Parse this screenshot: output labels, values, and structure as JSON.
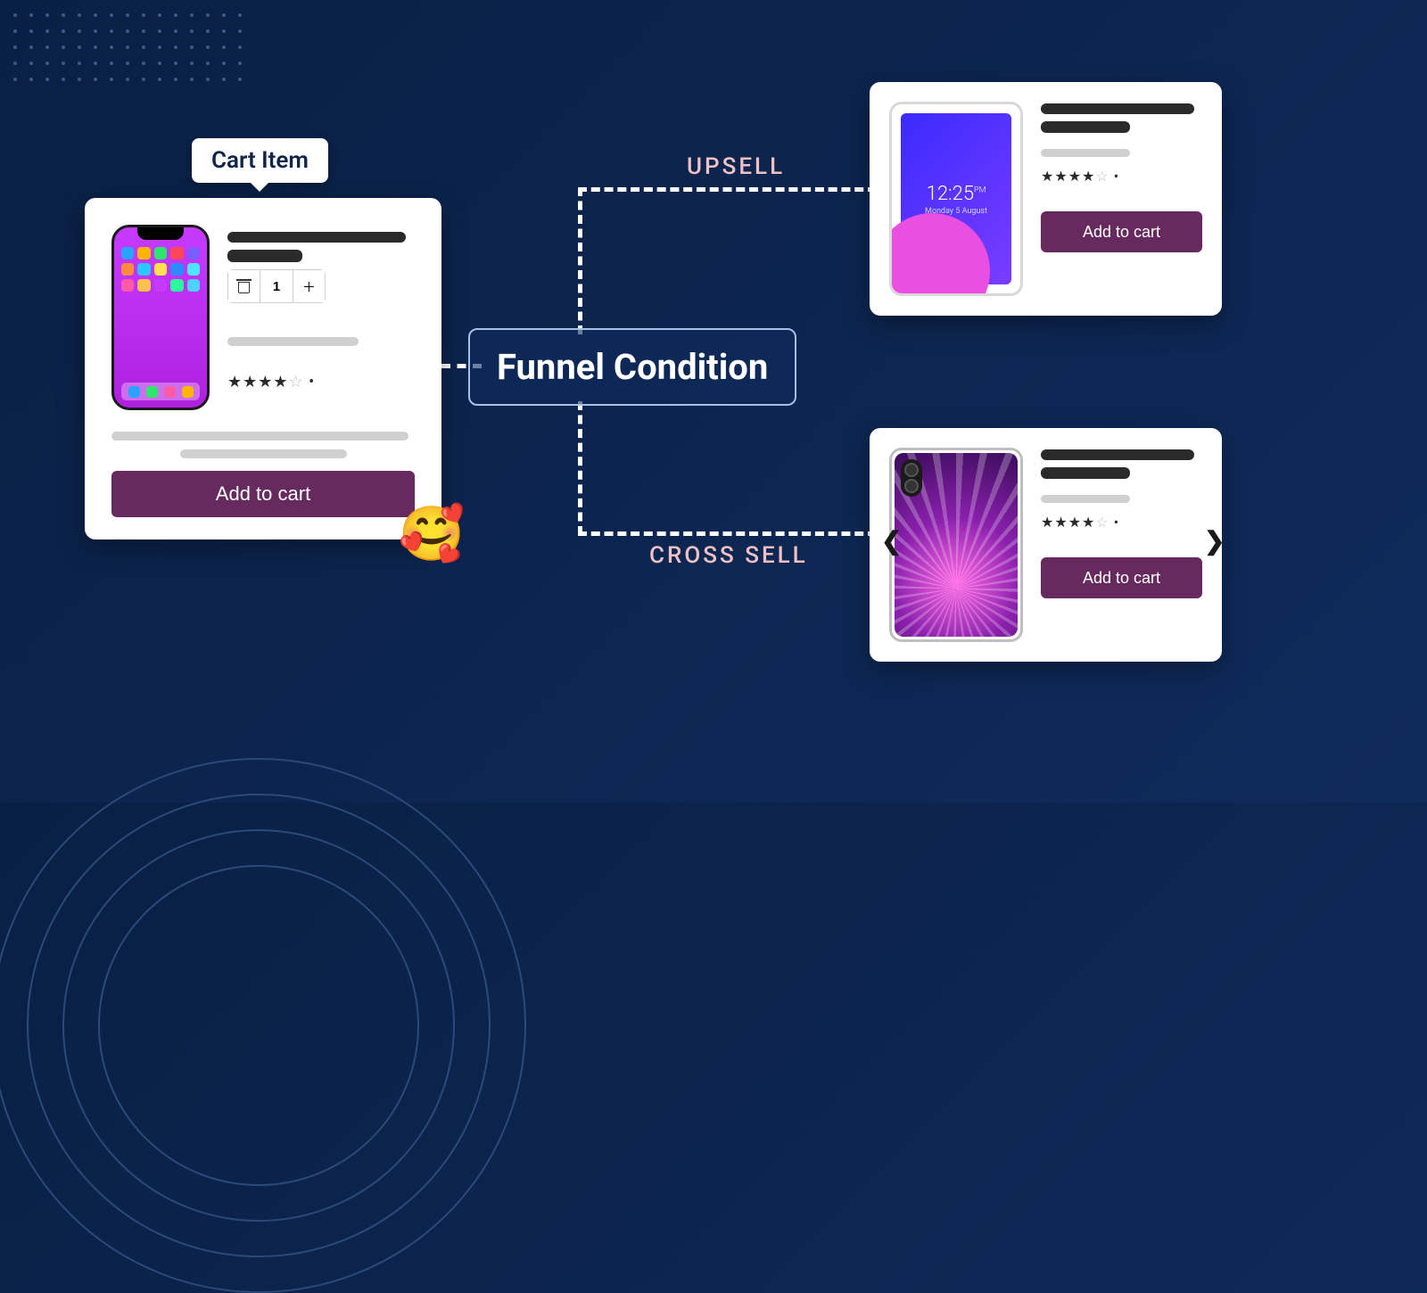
{
  "tooltip": "Cart Item",
  "center_node": "Funnel Condition",
  "labels": {
    "upsell": "UPSELL",
    "cross_sell": "CROSS SELL"
  },
  "cart": {
    "device_name": "smartphone",
    "quantity": "1",
    "rating": 4,
    "rating_max": 5,
    "add_to_cart": "Add to cart"
  },
  "upsell": {
    "device_name": "tablet",
    "lock_time": "12:25",
    "lock_time_suffix": "PM",
    "lock_date": "Monday 5 August",
    "rating": 4,
    "rating_max": 5,
    "add_to_cart": "Add to cart"
  },
  "cross_sell": {
    "device_name": "phone-case",
    "rating": 4,
    "rating_max": 5,
    "add_to_cart": "Add to cart"
  },
  "colors": {
    "button": "#662a5e",
    "bg_dark": "#0f2b5c",
    "accent_pink": "#eec2c2"
  },
  "icons": {
    "trash": "trash-icon",
    "plus": "plus-icon",
    "emoji": "smiling-face-with-hearts",
    "chevron_left": "chevron-left-icon",
    "chevron_right": "chevron-right-icon"
  }
}
